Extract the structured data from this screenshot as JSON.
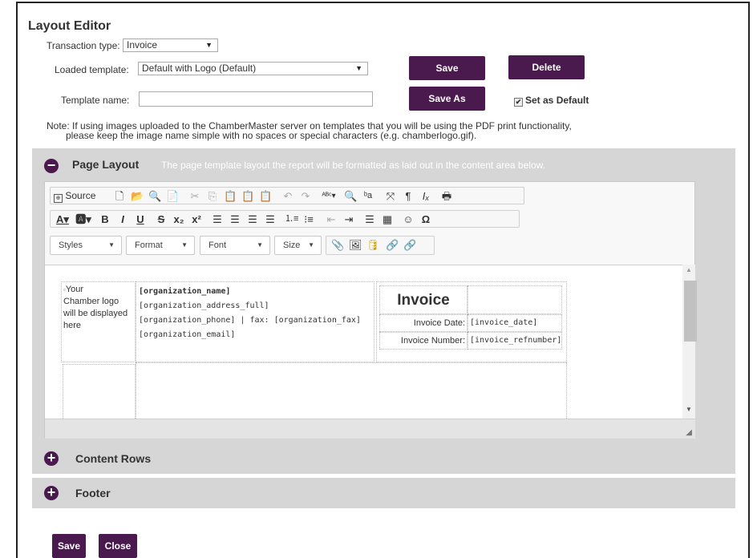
{
  "title": "Layout Editor",
  "transaction": {
    "label": "Transaction type:",
    "value": "Invoice"
  },
  "template": {
    "label": "Loaded template:",
    "value": "Default with Logo (Default)"
  },
  "template_name": {
    "label": "Template name:",
    "value": ""
  },
  "buttons": {
    "save": "Save",
    "delete": "Delete",
    "save_as": "Save As",
    "close": "Close"
  },
  "set_default": {
    "label": "Set as Default",
    "checked": true
  },
  "note": {
    "line1": "Note: If using images uploaded to the ChamberMaster server on templates that you will be using the PDF print functionality,",
    "line2": "please keep the image name simple with no spaces or special characters (e.g. chamberlogo.gif)."
  },
  "sections": {
    "page_layout": {
      "title": "Page Layout",
      "hint": "The page template layout the report will be formatted as laid out in the content area below."
    },
    "content_rows": {
      "title": "Content Rows"
    },
    "footer": {
      "title": "Footer"
    }
  },
  "toolbar": {
    "source": "Source",
    "combos": {
      "styles": "Styles",
      "format": "Format",
      "font": "Font",
      "size": "Size"
    }
  },
  "content": {
    "logo_alt": [
      "Your",
      "Chamber logo",
      "will be displayed",
      "here"
    ],
    "org_name": "[organization_name]",
    "org_address": "[organization_address_full]",
    "org_phone": "[organization_phone] | fax: [organization_fax]",
    "org_email": "[organization_email]",
    "invoice_heading": "Invoice",
    "invoice_date_label": "Invoice Date:",
    "invoice_date_value": "[invoice_date]",
    "invoice_number_label": "Invoice Number:",
    "invoice_number_value": "[invoice_refnumber]"
  },
  "colors": {
    "accent": "#4a1a4f",
    "section_bg": "#d6d6d6"
  }
}
